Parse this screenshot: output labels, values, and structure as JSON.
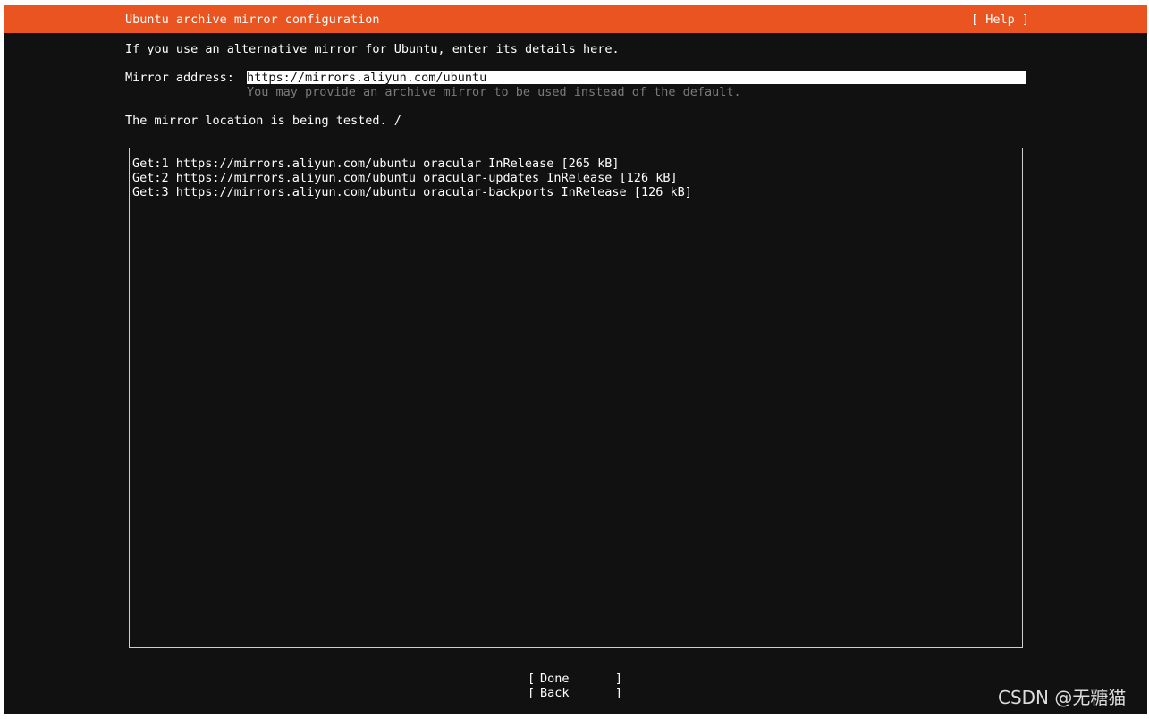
{
  "header": {
    "title": "Ubuntu archive mirror configuration",
    "help_label": "[ Help ]"
  },
  "intro_text": "If you use an alternative mirror for Ubuntu, enter its details here.",
  "mirror": {
    "label": "Mirror address:",
    "value": "https://mirrors.aliyun.com/ubuntu",
    "hint": "You may provide an archive mirror to be used instead of the default."
  },
  "status_text": "The mirror location is being tested. /",
  "log": {
    "lines": [
      "Get:1 https://mirrors.aliyun.com/ubuntu oracular InRelease [265 kB]",
      "Get:2 https://mirrors.aliyun.com/ubuntu oracular-updates InRelease [126 kB]",
      "Get:3 https://mirrors.aliyun.com/ubuntu oracular-backports InRelease [126 kB]"
    ]
  },
  "buttons": {
    "done_label": "Done",
    "back_label": "Back",
    "bracket_left": "[",
    "bracket_right": "]"
  },
  "watermark": "CSDN @无糖猫",
  "colors": {
    "header_bg": "#e95420",
    "screen_bg": "#111111",
    "text": "#ffffff",
    "hint_text": "#7a7a7a"
  }
}
